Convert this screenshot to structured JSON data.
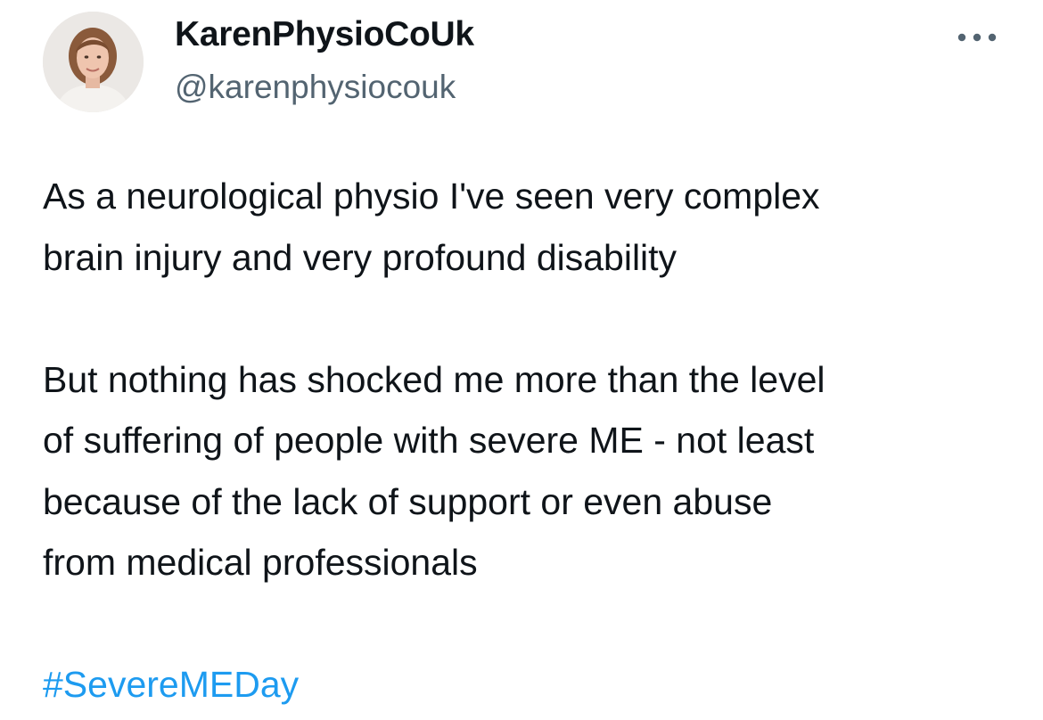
{
  "author": {
    "display_name": "KarenPhysioCoUk",
    "handle": "@karenphysiocouk"
  },
  "more_icon": "more-horizontal-icon",
  "tweet": {
    "paragraph_1": "As a neurological physio I've seen very complex\nbrain injury and very profound disability",
    "paragraph_2": "But nothing has shocked me more than the level\nof suffering of people with severe ME - not least\nbecause of the lack of support or even abuse\nfrom medical professionals",
    "hashtag": "#SevereMEDay"
  },
  "colors": {
    "text": "#0f1419",
    "secondary": "#536471",
    "link": "#1d9bf0"
  }
}
